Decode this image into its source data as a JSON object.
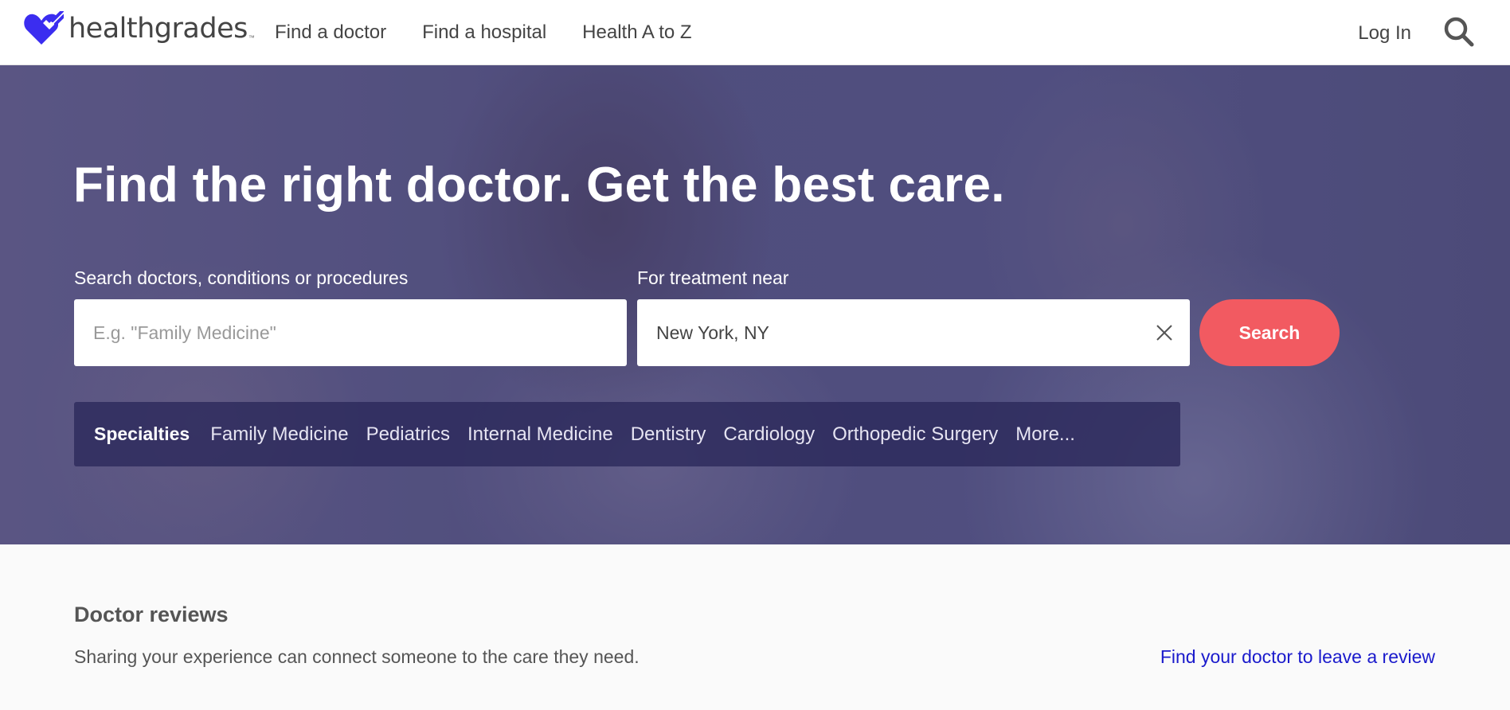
{
  "header": {
    "logo_text": "healthgrades",
    "logo_tm": "™",
    "nav": [
      "Find a doctor",
      "Find a hospital",
      "Health A to Z"
    ],
    "login": "Log In"
  },
  "hero": {
    "headline": "Find the right doctor. Get the best care.",
    "search_label": "Search doctors, conditions or procedures",
    "search_placeholder": "E.g. \"Family Medicine\"",
    "search_value": "",
    "location_label": "For treatment near",
    "location_value": "New York, NY",
    "search_button": "Search"
  },
  "specialties": {
    "title": "Specialties",
    "items": [
      "Family Medicine",
      "Pediatrics",
      "Internal Medicine",
      "Dentistry",
      "Cardiology",
      "Orthopedic Surgery",
      "More..."
    ]
  },
  "reviews": {
    "title": "Doctor reviews",
    "subtitle": "Sharing your experience can connect someone to the care they need.",
    "link": "Find your doctor to leave a review"
  },
  "colors": {
    "brand": "#3b2df0",
    "search_button": "#f25a61",
    "link": "#1a1acc"
  }
}
